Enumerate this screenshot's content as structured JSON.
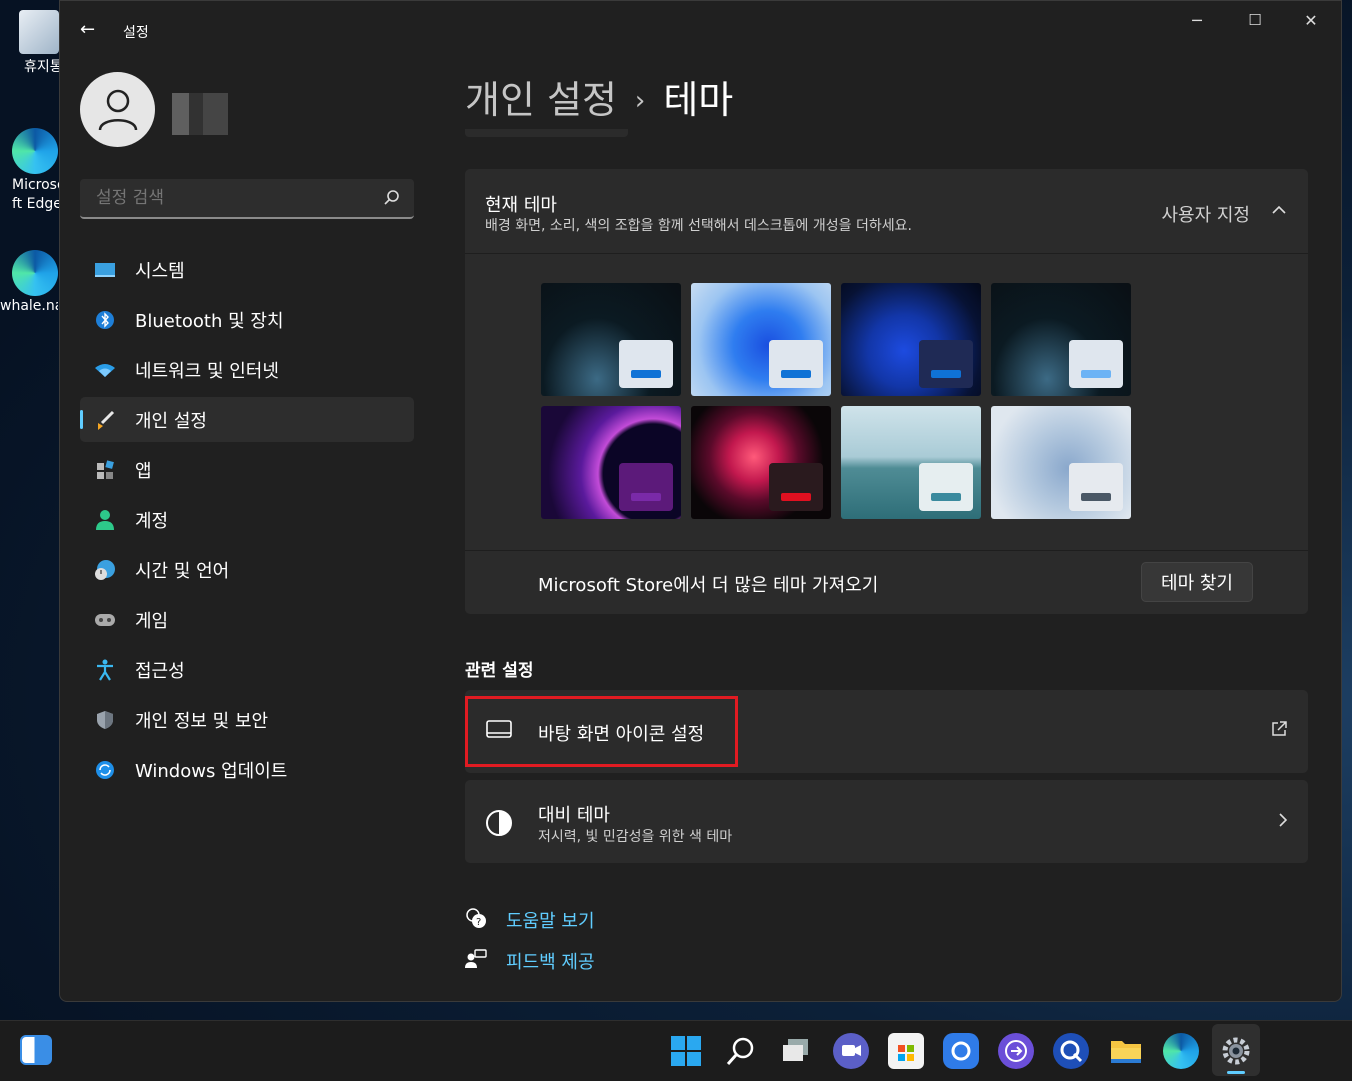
{
  "desktop": {
    "icons": [
      {
        "label": "휴지통"
      },
      {
        "label": "Microsoft Edge"
      },
      {
        "label": "whale.naver"
      }
    ]
  },
  "window": {
    "title": "설정",
    "controls": {
      "minimize": "─",
      "maximize": "☐",
      "close": "✕"
    }
  },
  "search": {
    "placeholder": "설정 검색"
  },
  "nav": {
    "items": [
      {
        "label": "시스템",
        "icon": "system-icon"
      },
      {
        "label": "Bluetooth 및 장치",
        "icon": "bluetooth-icon"
      },
      {
        "label": "네트워크 및 인터넷",
        "icon": "wifi-icon"
      },
      {
        "label": "개인 설정",
        "icon": "brush-icon",
        "active": true
      },
      {
        "label": "앱",
        "icon": "apps-icon"
      },
      {
        "label": "계정",
        "icon": "account-icon"
      },
      {
        "label": "시간 및 언어",
        "icon": "globe-clock-icon"
      },
      {
        "label": "게임",
        "icon": "gamepad-icon"
      },
      {
        "label": "접근성",
        "icon": "accessibility-icon"
      },
      {
        "label": "개인 정보 및 보안",
        "icon": "shield-icon"
      },
      {
        "label": "Windows 업데이트",
        "icon": "update-icon"
      }
    ]
  },
  "breadcrumb": {
    "parent": "개인 설정",
    "separator": "›",
    "current": "테마"
  },
  "current_theme": {
    "title": "현재 테마",
    "subtitle": "배경 화면, 소리, 색의 조합을 함께 선택해서 데스크톱에 개성을 더하세요.",
    "value": "사용자 지정",
    "store_text": "Microsoft Store에서 더 많은 테마 가져오기",
    "find_button": "테마 찾기"
  },
  "related": {
    "title": "관련 설정",
    "desktop_icons": "바탕 화면 아이콘 설정",
    "contrast_title": "대비 테마",
    "contrast_sub": "저시력, 빛 민감성을 위한 색 테마"
  },
  "links": {
    "help": "도움말 보기",
    "feedback": "피드백 제공"
  },
  "colors": {
    "accent": "#60cdff",
    "highlight_box": "#e11b22",
    "window_bg": "#202020",
    "card_bg": "#2b2b2b"
  }
}
